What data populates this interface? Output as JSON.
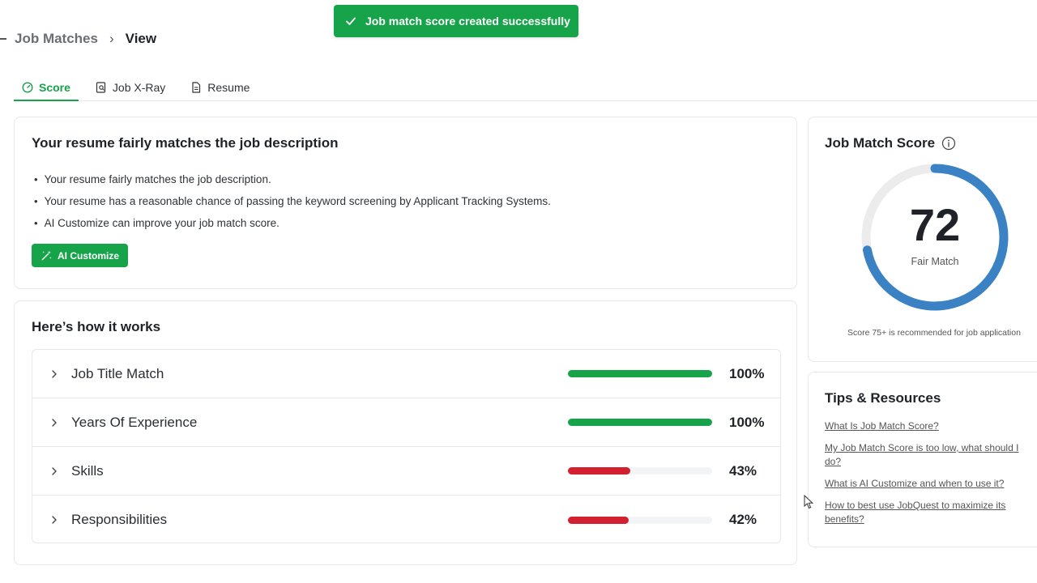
{
  "toast": {
    "message": "Job match score created successfully",
    "icon": "check-icon"
  },
  "breadcrumb": {
    "parent": "Job Matches",
    "separator": "›",
    "current": "View"
  },
  "tabs": [
    {
      "label": "Score",
      "icon": "gauge-icon",
      "active": true
    },
    {
      "label": "Job X-Ray",
      "icon": "document-search-icon",
      "active": false
    },
    {
      "label": "Resume",
      "icon": "document-icon",
      "active": false
    }
  ],
  "summary": {
    "title": "Your resume fairly matches the job description",
    "bullets": [
      "Your resume fairly matches the job description.",
      "Your resume has a reasonable chance of passing the keyword screening by Applicant Tracking Systems.",
      "AI Customize can improve your job match score."
    ],
    "button_label": "AI Customize"
  },
  "how_it_works": {
    "title": "Here’s how it works",
    "criteria": [
      {
        "label": "Job Title Match",
        "percent_label": "100%",
        "fraction": 1.0,
        "color": "#16a34a"
      },
      {
        "label": "Years Of Experience",
        "percent_label": "100%",
        "fraction": 1.0,
        "color": "#16a34a"
      },
      {
        "label": "Skills",
        "percent_label": "43%",
        "fraction": 0.43,
        "color": "#d32030"
      },
      {
        "label": "Responsibilities",
        "percent_label": "42%",
        "fraction": 0.42,
        "color": "#d32030"
      }
    ]
  },
  "score": {
    "title": "Job Match Score",
    "value": "72",
    "fraction": 0.72,
    "label": "Fair Match",
    "note": "Score 75+ is recommended for job application",
    "arc_color": "#3b82c4",
    "track_color": "#ececec"
  },
  "tips": {
    "title": "Tips & Resources",
    "links": [
      "What Is Job Match Score?",
      "My Job Match Score is too low, what should I do?",
      "What is AI Customize and when to use it?",
      "How to best use JobQuest to maximize its benefits?"
    ]
  },
  "colors": {
    "brand": "#16a34a",
    "danger": "#d32030"
  }
}
